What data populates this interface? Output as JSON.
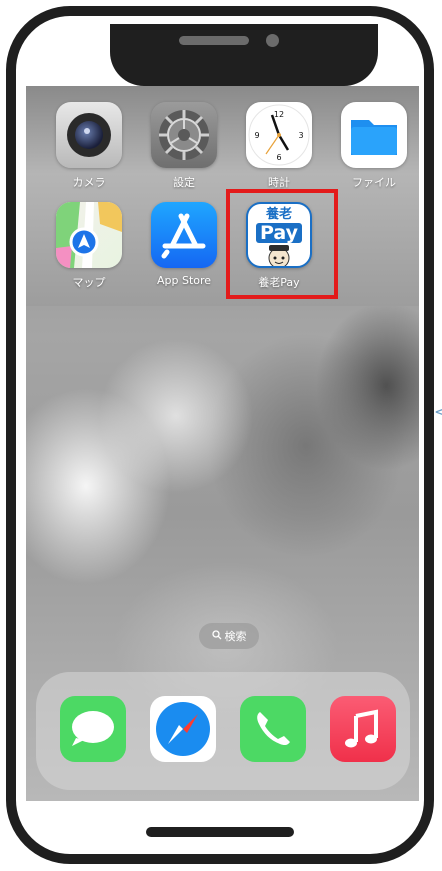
{
  "apps_row1": [
    {
      "label": "カメラ",
      "icon": "camera-icon"
    },
    {
      "label": "設定",
      "icon": "settings-icon"
    },
    {
      "label": "時計",
      "icon": "clock-icon"
    },
    {
      "label": "ファイル",
      "icon": "files-icon"
    }
  ],
  "apps_row2": [
    {
      "label": "マップ",
      "icon": "maps-icon"
    },
    {
      "label": "App Store",
      "icon": "app-store-icon"
    },
    {
      "label": "養老Pay",
      "icon": "yoro-pay-icon",
      "icon_text_top": "養老",
      "icon_text_mid": "Pay"
    }
  ],
  "clock": {
    "n12": "12",
    "n3": "3",
    "n6": "6",
    "n9": "9"
  },
  "search": {
    "icon": "search-icon",
    "label": "検索"
  },
  "dock": [
    {
      "icon": "messages-icon"
    },
    {
      "icon": "safari-icon"
    },
    {
      "icon": "phone-icon"
    },
    {
      "icon": "music-icon"
    }
  ],
  "colors": {
    "highlight": "#e31b1b",
    "pay_blue": "#1a6fc5",
    "appstore_blue": "#1567f3",
    "green": "#4cd964",
    "music_red": "#fa4455"
  }
}
